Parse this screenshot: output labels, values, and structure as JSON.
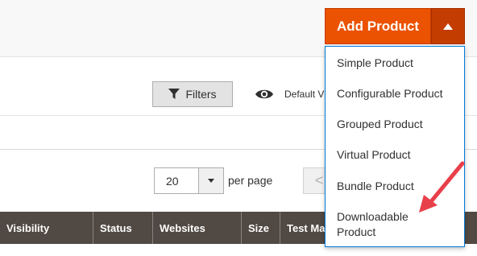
{
  "toolbar": {
    "add_product_label": "Add Product"
  },
  "add_menu": {
    "items": [
      {
        "label": "Simple Product"
      },
      {
        "label": "Configurable Product"
      },
      {
        "label": "Grouped Product"
      },
      {
        "label": "Virtual Product"
      },
      {
        "label": "Bundle Product"
      },
      {
        "label": "Downloadable\nProduct"
      }
    ]
  },
  "controls": {
    "filters_label": "Filters",
    "view_label": "Default V",
    "per_page_value": "20",
    "per_page_label": "per page",
    "prev_label": "<"
  },
  "grid": {
    "columns": [
      "Visibility",
      "Status",
      "Websites",
      "Size",
      "Test Ma"
    ]
  },
  "colors": {
    "primary_button": "#eb5202",
    "grid_header": "#514943",
    "annotation_arrow": "#e8404a",
    "dropdown_border": "#007bdb"
  },
  "icons": {
    "filter": "funnel-icon",
    "view": "eye-icon",
    "toggle": "triangle-up-icon",
    "select": "triangle-down-icon"
  }
}
